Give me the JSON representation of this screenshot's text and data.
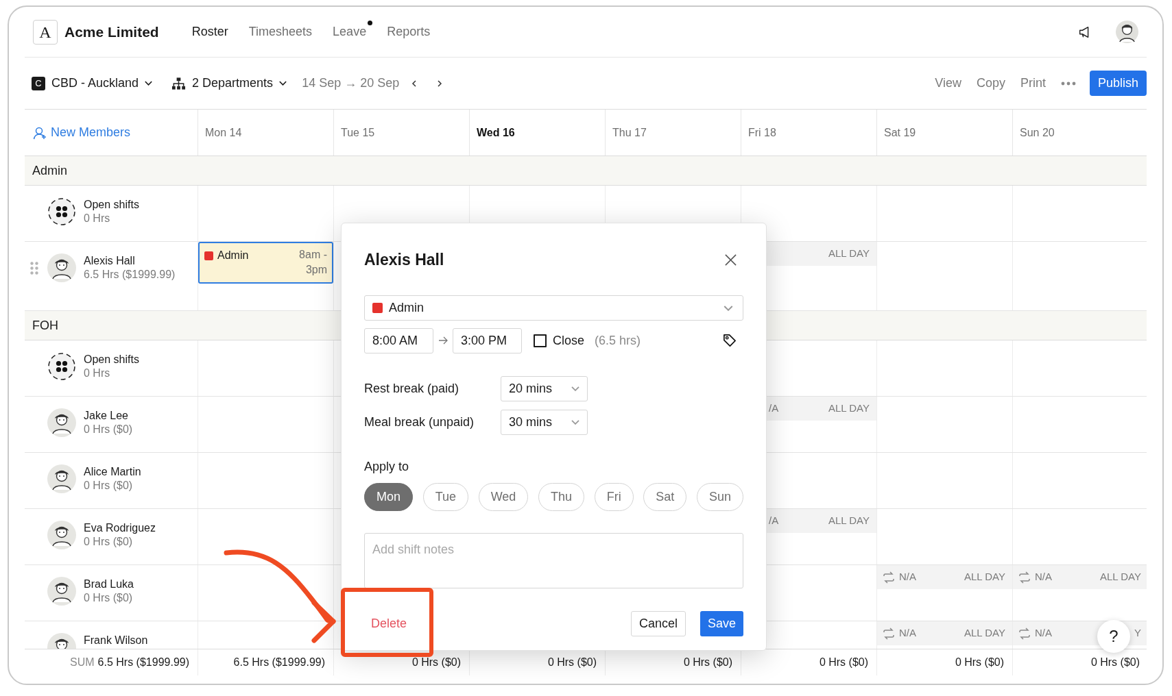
{
  "app": {
    "logo": "A",
    "name": "Acme Limited"
  },
  "nav": [
    {
      "label": "Roster",
      "selected": true,
      "dot": false
    },
    {
      "label": "Timesheets",
      "selected": false,
      "dot": false
    },
    {
      "label": "Leave",
      "selected": false,
      "dot": true
    },
    {
      "label": "Reports",
      "selected": false,
      "dot": false
    }
  ],
  "toolbar": {
    "location_badge": "C",
    "location": "CBD - Auckland",
    "departments": "2 Departments",
    "date_range": "14 Sep → 20 Sep",
    "actions": [
      "View",
      "Copy",
      "Print"
    ],
    "publish": "Publish"
  },
  "grid": {
    "new_members": "New Members",
    "days": [
      {
        "label": "Mon 14",
        "today": false
      },
      {
        "label": "Tue 15",
        "today": false
      },
      {
        "label": "Wed 16",
        "today": true
      },
      {
        "label": "Thu 17",
        "today": false
      },
      {
        "label": "Fri 18",
        "today": false
      },
      {
        "label": "Sat 19",
        "today": false
      },
      {
        "label": "Sun 20",
        "today": false
      }
    ],
    "groups": [
      {
        "name": "Admin",
        "rows": [
          {
            "kind": "open",
            "name": "Open shifts",
            "hours": "0 Hrs",
            "drag_handle": false,
            "cells": [
              {
                "kind": "empty"
              },
              {
                "kind": "empty"
              },
              {
                "kind": "empty"
              },
              {
                "kind": "empty"
              },
              {
                "kind": "empty"
              },
              {
                "kind": "empty"
              },
              {
                "kind": "empty"
              }
            ]
          },
          {
            "kind": "person",
            "name": "Alexis Hall",
            "hours": "6.5 Hrs ($1999.99)",
            "drag_handle": true,
            "cells": [
              {
                "kind": "shift",
                "label": "Admin",
                "color": "#e5322d",
                "time": "8am - 3pm",
                "selected": true
              },
              {
                "kind": "empty"
              },
              {
                "kind": "empty"
              },
              {
                "kind": "empty"
              },
              {
                "kind": "unavailable",
                "repeat": false,
                "allday": "ALL DAY"
              },
              {
                "kind": "empty"
              },
              {
                "kind": "empty"
              }
            ]
          }
        ]
      },
      {
        "name": "FOH",
        "rows": [
          {
            "kind": "open",
            "name": "Open shifts",
            "hours": "0 Hrs",
            "drag_handle": false,
            "cells": [
              {
                "kind": "empty"
              },
              {
                "kind": "empty"
              },
              {
                "kind": "empty"
              },
              {
                "kind": "empty"
              },
              {
                "kind": "empty"
              },
              {
                "kind": "empty"
              },
              {
                "kind": "empty"
              }
            ]
          },
          {
            "kind": "person",
            "name": "Jake Lee",
            "hours": "0 Hrs ($0)",
            "drag_handle": false,
            "cells": [
              {
                "kind": "empty"
              },
              {
                "kind": "empty"
              },
              {
                "kind": "empty"
              },
              {
                "kind": "empty"
              },
              {
                "kind": "unavailable",
                "repeat": false,
                "na": "/A",
                "allday": "ALL DAY"
              },
              {
                "kind": "empty"
              },
              {
                "kind": "empty"
              }
            ]
          },
          {
            "kind": "person",
            "name": "Alice Martin",
            "hours": "0 Hrs ($0)",
            "drag_handle": false,
            "cells": [
              {
                "kind": "empty"
              },
              {
                "kind": "empty"
              },
              {
                "kind": "empty"
              },
              {
                "kind": "empty"
              },
              {
                "kind": "empty"
              },
              {
                "kind": "empty"
              },
              {
                "kind": "empty"
              }
            ]
          },
          {
            "kind": "person",
            "name": "Eva Rodriguez",
            "hours": "0 Hrs ($0)",
            "drag_handle": false,
            "cells": [
              {
                "kind": "empty"
              },
              {
                "kind": "empty"
              },
              {
                "kind": "empty"
              },
              {
                "kind": "empty"
              },
              {
                "kind": "unavailable",
                "repeat": false,
                "na": "/A",
                "allday": "ALL DAY"
              },
              {
                "kind": "empty"
              },
              {
                "kind": "empty"
              }
            ]
          },
          {
            "kind": "person",
            "name": "Brad Luka",
            "hours": "0 Hrs ($0)",
            "drag_handle": false,
            "cells": [
              {
                "kind": "empty"
              },
              {
                "kind": "empty"
              },
              {
                "kind": "empty"
              },
              {
                "kind": "empty"
              },
              {
                "kind": "empty"
              },
              {
                "kind": "unavailable",
                "repeat": true,
                "na": "N/A",
                "allday": "ALL DAY"
              },
              {
                "kind": "unavailable",
                "repeat": true,
                "na": "N/A",
                "allday": "ALL DAY"
              }
            ]
          },
          {
            "kind": "person",
            "name": "Frank Wilson",
            "drag_handle": false,
            "cells": [
              {
                "kind": "empty"
              },
              {
                "kind": "empty"
              },
              {
                "kind": "empty"
              },
              {
                "kind": "empty"
              },
              {
                "kind": "empty"
              },
              {
                "kind": "unavailable",
                "repeat": true,
                "na": "N/A",
                "allday": "ALL DAY"
              },
              {
                "kind": "unavailable",
                "repeat": true,
                "na": "N/A",
                "allday": "Y"
              }
            ]
          }
        ]
      }
    ],
    "sum_label": "SUM",
    "sum_total": "6.5 Hrs ($1999.99)",
    "day_totals": [
      "6.5 Hrs ($1999.99)",
      "0 Hrs ($0)",
      "0 Hrs ($0)",
      "0 Hrs ($0)",
      "0 Hrs ($0)",
      "0 Hrs ($0)",
      "0 Hrs ($0)"
    ]
  },
  "modal": {
    "title": "Alexis Hall",
    "role": {
      "label": "Admin",
      "color": "#e5322d"
    },
    "start": "8:00 AM",
    "end": "3:00 PM",
    "close_label": "Close",
    "close_checked": false,
    "duration": "(6.5 hrs)",
    "breaks": [
      {
        "label": "Rest break (paid)",
        "value": "20 mins"
      },
      {
        "label": "Meal break (unpaid)",
        "value": "30 mins"
      }
    ],
    "apply_label": "Apply to",
    "days": [
      {
        "label": "Mon",
        "selected": true
      },
      {
        "label": "Tue",
        "selected": false
      },
      {
        "label": "Wed",
        "selected": false
      },
      {
        "label": "Thu",
        "selected": false
      },
      {
        "label": "Fri",
        "selected": false
      },
      {
        "label": "Sat",
        "selected": false
      },
      {
        "label": "Sun",
        "selected": false
      }
    ],
    "notes_placeholder": "Add shift notes",
    "delete": "Delete",
    "cancel": "Cancel",
    "save": "Save"
  },
  "help_button": "?"
}
